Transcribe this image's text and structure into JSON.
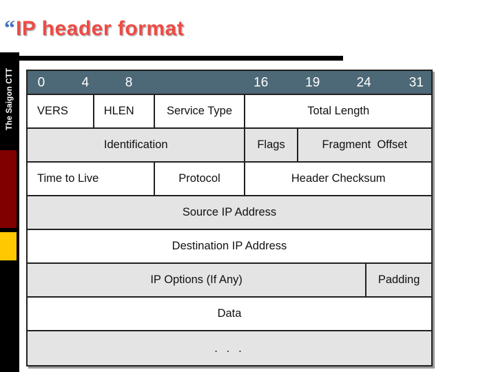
{
  "slide": {
    "title_bullet": "“",
    "title": "IP header format",
    "title_color": "#EE4B44",
    "bullet_color": "#4472C4",
    "rule_color": "#000000"
  },
  "sidebar": {
    "label": "The Saigon CTT",
    "background": "#000000",
    "block_red": "#800000",
    "block_gold": "#FFC800"
  },
  "diagram": {
    "name": "ip-header-format",
    "header_fill": "#4D6876",
    "row_fill_alt": "#E4E4E4",
    "row_fill": "#FFFFFF",
    "border_color": "#202020",
    "bit_ruler": [
      {
        "label": "0",
        "left_pct": 2.5
      },
      {
        "label": "4",
        "left_pct": 13.4
      },
      {
        "label": "8",
        "left_pct": 24.2
      },
      {
        "label": "16",
        "left_pct": 56.0
      },
      {
        "label": "19",
        "left_pct": 68.8
      },
      {
        "label": "24",
        "left_pct": 81.5
      },
      {
        "label": "31",
        "left_pct": 94.5
      }
    ],
    "rows": [
      {
        "shade": "white",
        "cells": [
          {
            "label": "VERS",
            "width_pct": 16.5,
            "align": "left"
          },
          {
            "label": "HLEN",
            "width_pct": 15.0,
            "align": "left"
          },
          {
            "label": "Service Type",
            "width_pct": 22.5,
            "align": "center"
          },
          {
            "label": "Total Length",
            "width_pct": 46.0,
            "align": "center"
          }
        ]
      },
      {
        "shade": "gray",
        "cells": [
          {
            "label": "Identification",
            "width_pct": 54.0,
            "align": "center"
          },
          {
            "label": "Flags",
            "width_pct": 13.0,
            "align": "center"
          },
          {
            "label": "Fragment  Offset",
            "width_pct": 33.0,
            "align": "center"
          }
        ]
      },
      {
        "shade": "white",
        "cells": [
          {
            "label": "Time to Live",
            "width_pct": 31.5,
            "align": "left"
          },
          {
            "label": "Protocol",
            "width_pct": 22.5,
            "align": "center"
          },
          {
            "label": "Header Checksum",
            "width_pct": 46.0,
            "align": "center"
          }
        ]
      },
      {
        "shade": "gray",
        "cells": [
          {
            "label": "Source IP Address",
            "width_pct": 100,
            "align": "center"
          }
        ]
      },
      {
        "shade": "white",
        "cells": [
          {
            "label": "Destination IP Address",
            "width_pct": 100,
            "align": "center"
          }
        ]
      },
      {
        "shade": "gray",
        "cells": [
          {
            "label": "IP Options (If Any)",
            "width_pct": 84.0,
            "align": "center"
          },
          {
            "label": "Padding",
            "width_pct": 16.0,
            "align": "center"
          }
        ]
      },
      {
        "shade": "white",
        "cells": [
          {
            "label": "Data",
            "width_pct": 100,
            "align": "center"
          }
        ]
      },
      {
        "shade": "gray",
        "cells": [
          {
            "label": ". . .",
            "width_pct": 100,
            "align": "center",
            "dots": true
          }
        ]
      }
    ]
  }
}
